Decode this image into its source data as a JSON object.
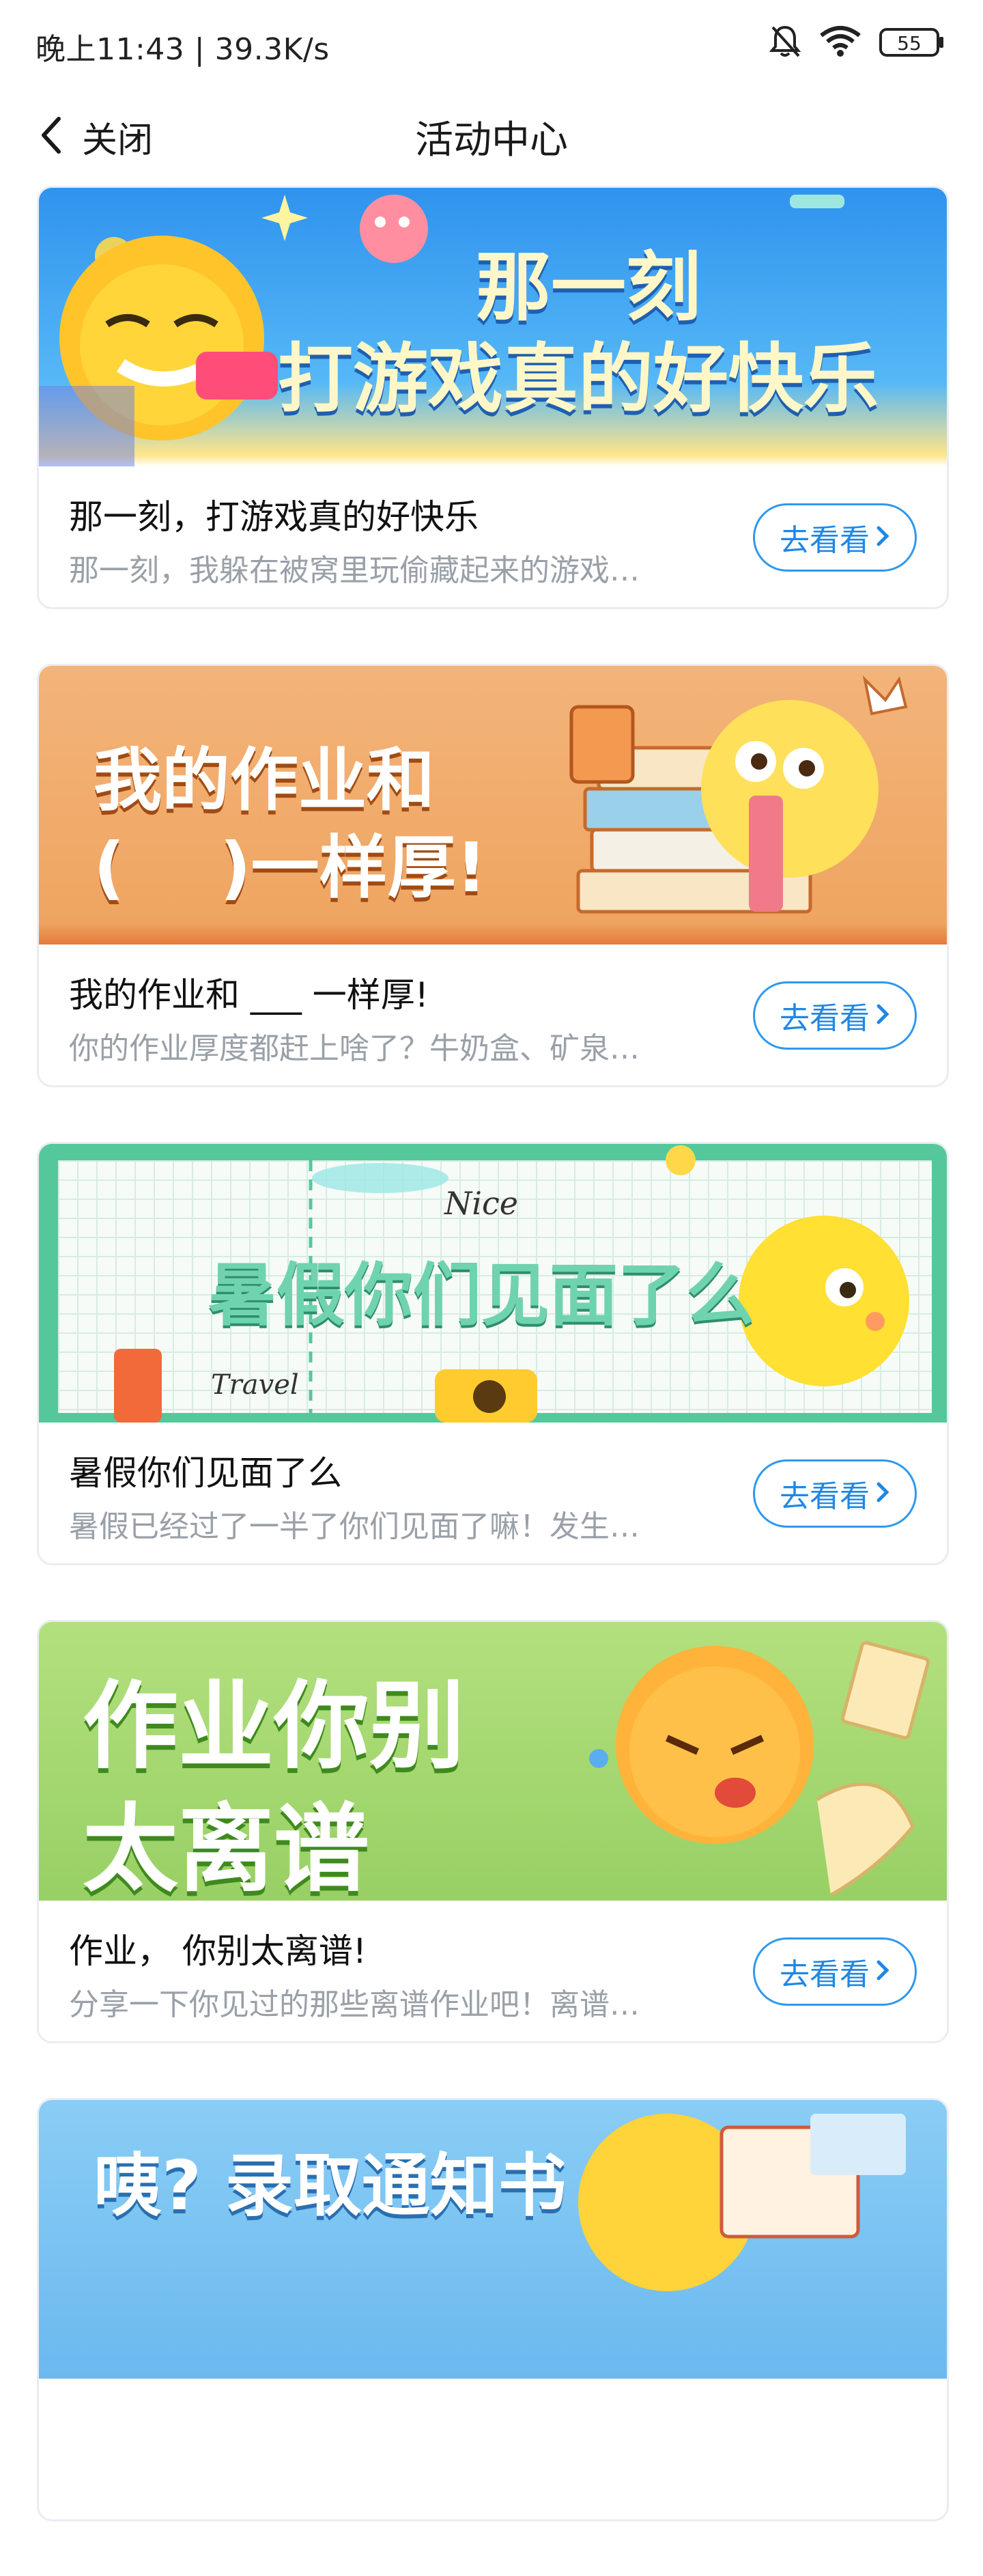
{
  "status": {
    "time_speed": "晚上11:43 | 39.3K/s",
    "battery": "55"
  },
  "nav": {
    "back_label": "关闭",
    "title": "活动中心"
  },
  "cards": [
    {
      "banner_line1": "那一刻",
      "banner_line2": "打游戏真的好快乐",
      "title": "那一刻，打游戏真的好快乐",
      "desc": "那一刻，我躲在被窝里玩偷藏起来的游戏…",
      "button": "去看看"
    },
    {
      "banner_line1": "我的作业和",
      "banner_line2": "(    )一样厚!",
      "title": "我的作业和 ___ 一样厚!",
      "desc": "你的作业厚度都赶上啥了？牛奶盒、矿泉…",
      "button": "去看看"
    },
    {
      "banner_line1": "暑假你们见面了么",
      "banner_tag1": "Nice",
      "banner_tag2": "Travel",
      "title": "暑假你们见面了么",
      "desc": "暑假已经过了一半了你们见面了嘛！发生…",
      "button": "去看看"
    },
    {
      "banner_line1": "作业你别",
      "banner_line2": "太离谱",
      "title": "作业， 你别太离谱!",
      "desc": "分享一下你见过的那些离谱作业吧！离谱…",
      "button": "去看看"
    },
    {
      "banner_line1": "咦? 录取通知书"
    }
  ],
  "colors": {
    "accent": "#2f98ef",
    "banner1": "#3aa6f0",
    "banner2": "#f0a866",
    "banner3": "#54c89a",
    "banner4": "#9ed46a",
    "banner5": "#7cc2f2"
  }
}
